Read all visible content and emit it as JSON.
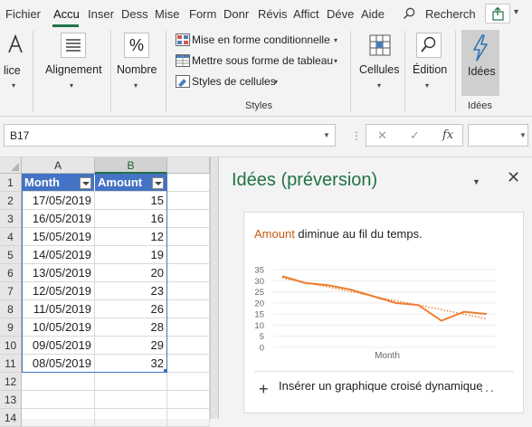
{
  "tabs": [
    "Fichier",
    "Accu",
    "Inser",
    "Dess",
    "Mise",
    "Form",
    "Donr",
    "Révis",
    "Affict",
    "Déve",
    "Aide"
  ],
  "active_tab": "Accu",
  "search": {
    "label": "Recherch"
  },
  "ribbon": {
    "police": "lice",
    "alignement": "Alignement",
    "nombre": "Nombre",
    "nombre_symbol": "%",
    "mise_en_forme_cond": "Mise en forme conditionnelle",
    "mettre_sous_forme": "Mettre sous forme de tableau",
    "styles_cellules": "Styles de cellules",
    "styles_group": "Styles",
    "cellules": "Cellules",
    "edition": "Édition",
    "idees": "Idées",
    "idees_group": "Idées"
  },
  "formula_bar": {
    "name_box": "B17",
    "cancel": "✕",
    "enter": "✓",
    "fx": "fx"
  },
  "sheet": {
    "columns": [
      "A",
      "B"
    ],
    "rows": [
      "1",
      "2",
      "3",
      "4",
      "5",
      "6",
      "7",
      "8",
      "9",
      "10",
      "11",
      "12",
      "13",
      "14"
    ],
    "headers": [
      "Month",
      "Amount"
    ],
    "data": [
      [
        "17/05/2019",
        "15"
      ],
      [
        "16/05/2019",
        "16"
      ],
      [
        "15/05/2019",
        "12"
      ],
      [
        "14/05/2019",
        "19"
      ],
      [
        "13/05/2019",
        "20"
      ],
      [
        "12/05/2019",
        "23"
      ],
      [
        "11/05/2019",
        "26"
      ],
      [
        "10/05/2019",
        "28"
      ],
      [
        "09/05/2019",
        "29"
      ],
      [
        "08/05/2019",
        "32"
      ]
    ]
  },
  "pane": {
    "title": "Idées (préversion)",
    "close": "✕",
    "headline_accent": "Amount",
    "headline_rest": " diminue au fil du temps.",
    "action_label": "Insérer un graphique croisé dynamique",
    "more": "···"
  },
  "chart_data": {
    "type": "line",
    "xlabel": "Month",
    "ylabel": "",
    "ylim": [
      0,
      35
    ],
    "yticks": [
      0,
      5,
      10,
      15,
      20,
      25,
      30,
      35
    ],
    "series": [
      {
        "name": "",
        "values": [
          32,
          29,
          28,
          26,
          23,
          20,
          19,
          12,
          16,
          15
        ],
        "color": "#ed7d31",
        "style": "solid"
      },
      {
        "name": "",
        "values": [
          31.2,
          29.2,
          27.2,
          25.1,
          23.1,
          21.0,
          19.0,
          17.0,
          14.9,
          12.9
        ],
        "color": "#ed7d31",
        "style": "dotted"
      }
    ]
  },
  "colors": {
    "accent": "#217346",
    "table_header": "#4472c4",
    "series": "#ed7d31"
  }
}
